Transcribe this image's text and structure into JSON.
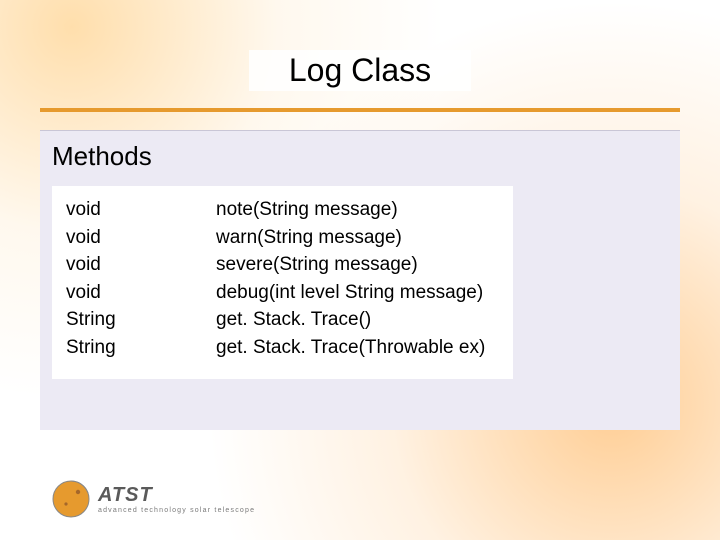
{
  "title": "Log Class",
  "section_heading": "Methods",
  "methods": [
    {
      "ret": "void",
      "sig": "note(String message)"
    },
    {
      "ret": "void",
      "sig": "warn(String message)"
    },
    {
      "ret": "void",
      "sig": "severe(String message)"
    },
    {
      "ret": "void",
      "sig": "debug(int level String message)"
    },
    {
      "ret": "String",
      "sig": "get. Stack. Trace()"
    },
    {
      "ret": "String",
      "sig": "get. Stack. Trace(Throwable ex)"
    }
  ],
  "logo": {
    "acronym": "ATST",
    "subtitle": "advanced technology solar telescope"
  },
  "accent_color": "#e69a2e"
}
